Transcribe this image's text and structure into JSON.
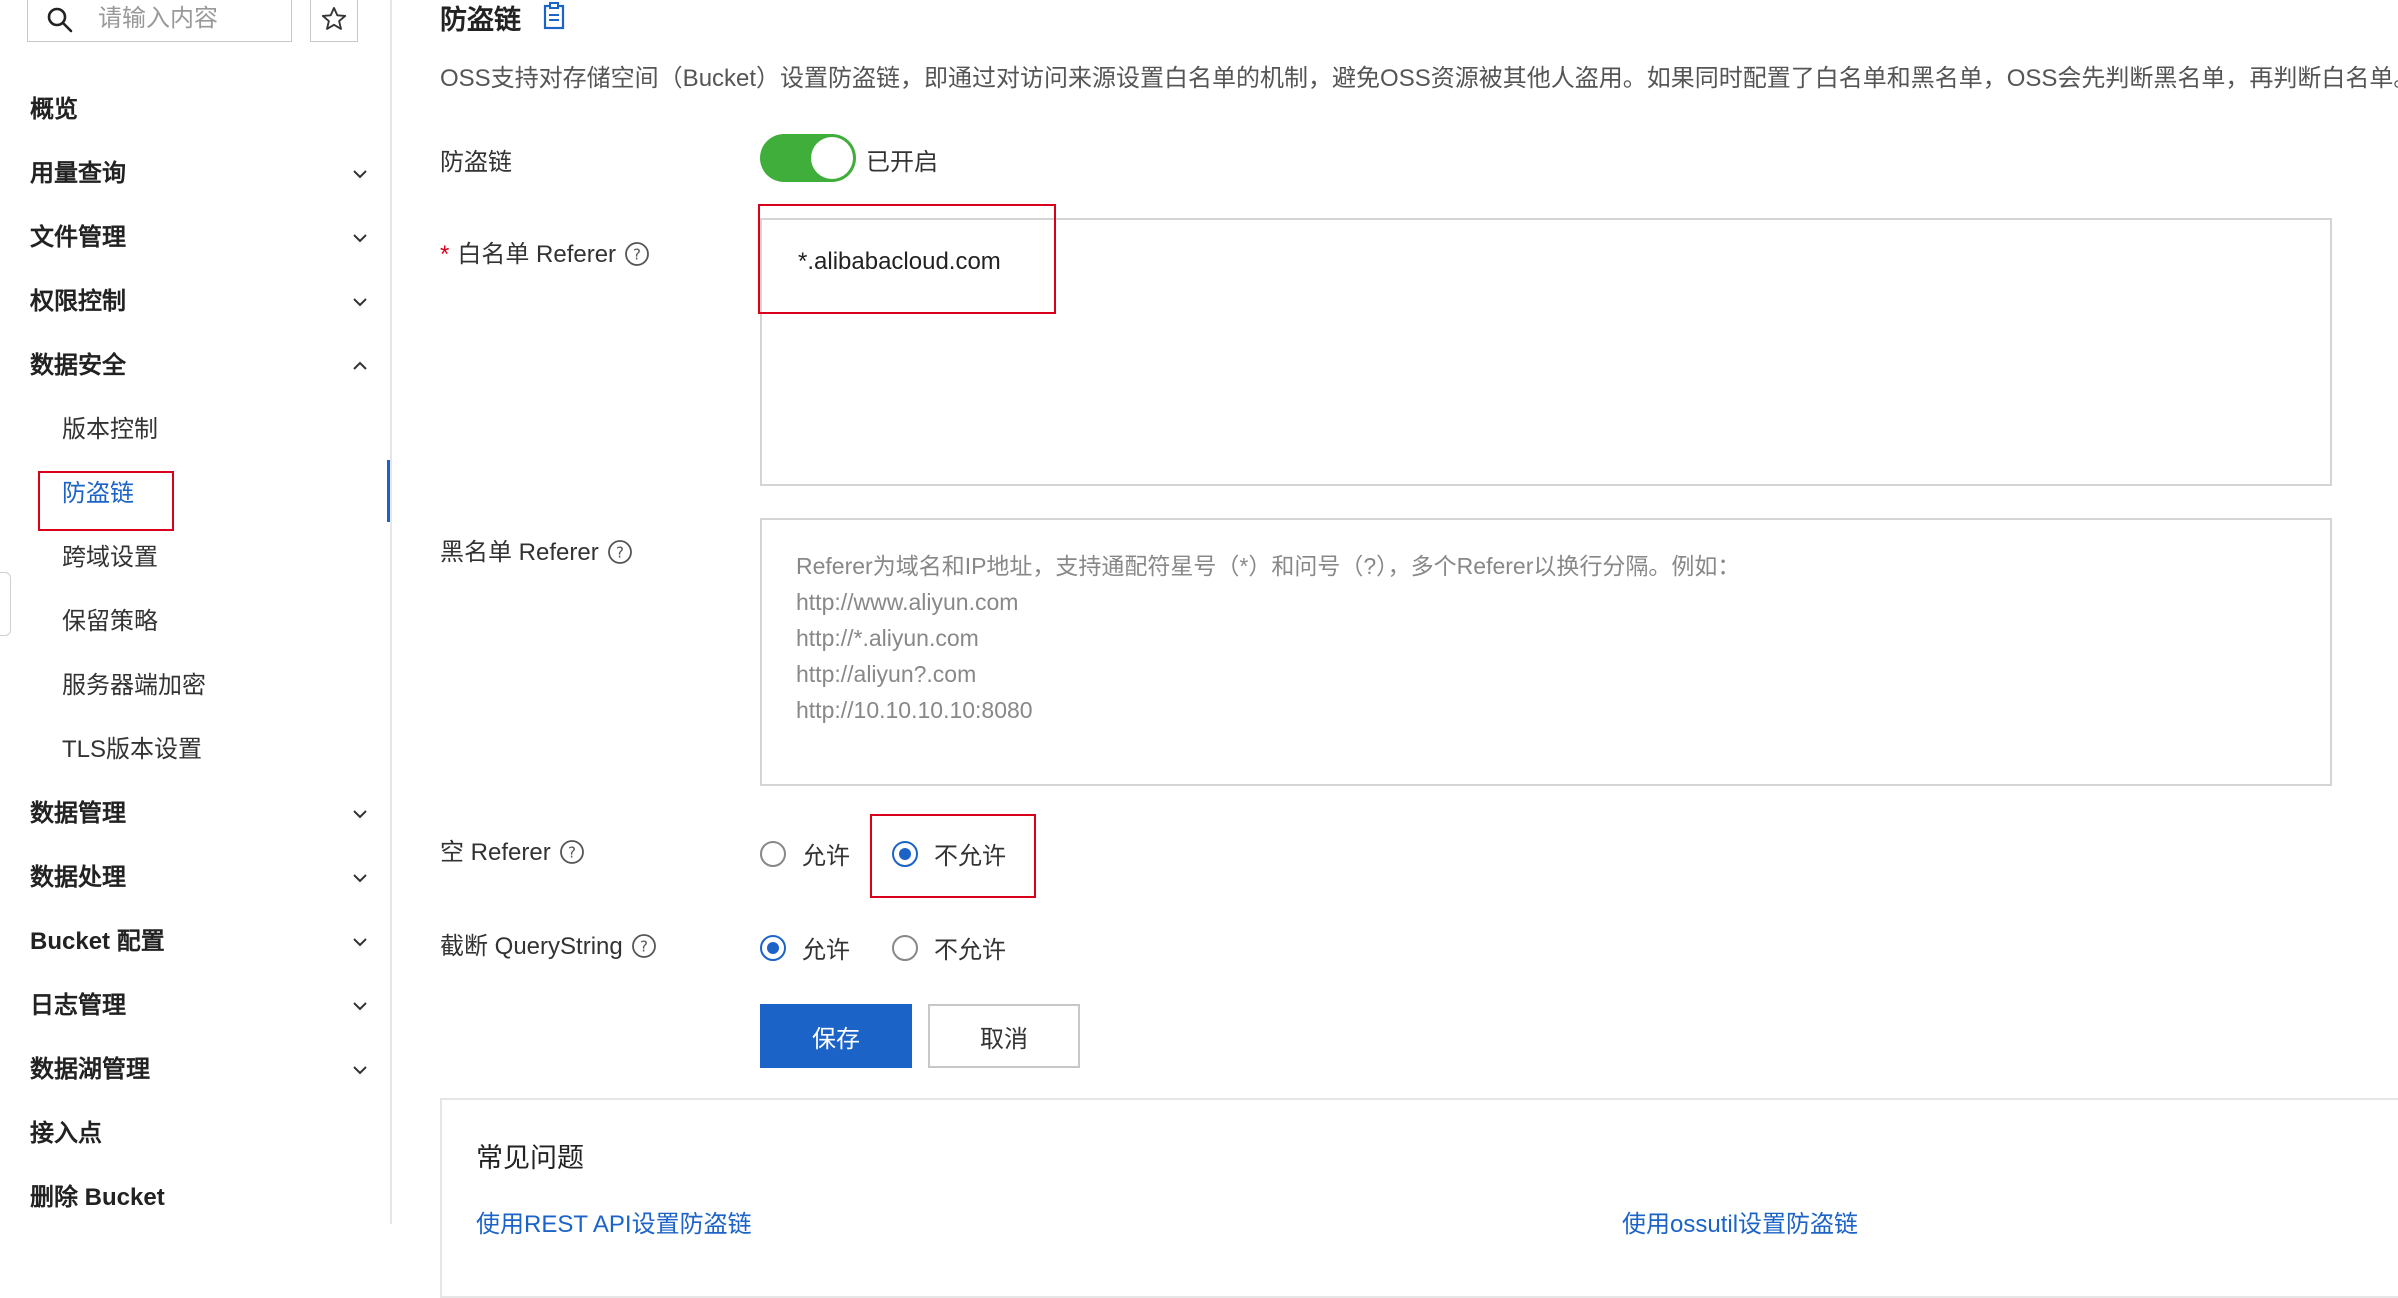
{
  "sidebar": {
    "search_placeholder": "请输入内容",
    "menu": [
      {
        "label": "概览",
        "chevron": "none"
      },
      {
        "label": "用量查询",
        "chevron": "down"
      },
      {
        "label": "文件管理",
        "chevron": "down"
      },
      {
        "label": "权限控制",
        "chevron": "down"
      },
      {
        "label": "数据安全",
        "chevron": "up"
      }
    ],
    "sub_items": [
      "版本控制",
      "防盗链",
      "跨域设置",
      "保留策略",
      "服务器端加密",
      "TLS版本设置"
    ],
    "active_sub_item": "防盗链",
    "menu_after": [
      {
        "label": "数据管理",
        "chevron": "down"
      },
      {
        "label": "数据处理",
        "chevron": "down"
      },
      {
        "label": "Bucket 配置",
        "chevron": "down"
      },
      {
        "label": "日志管理",
        "chevron": "down"
      },
      {
        "label": "数据湖管理",
        "chevron": "down"
      },
      {
        "label": "接入点",
        "chevron": "none"
      },
      {
        "label": "删除 Bucket",
        "chevron": "none"
      }
    ]
  },
  "page": {
    "title": "防盗链",
    "description": "OSS支持对存储空间（Bucket）设置防盗链，即通过对访问来源设置白名单的机制，避免OSS资源被其他人盗用。如果同时配置了白名单和黑名单，OSS会先判断黑名单，再判断白名单。"
  },
  "form": {
    "hotlink_label": "防盗链",
    "hotlink_status": "已开启",
    "hotlink_enabled": true,
    "whitelist_required_mark": "*",
    "whitelist_label": "白名单 Referer",
    "whitelist_value": "*.alibabacloud.com",
    "blacklist_label": "黑名单 Referer",
    "blacklist_placeholder": [
      "Referer为域名和IP地址，支持通配符星号（*）和问号（?），多个Referer以换行分隔。例如：",
      "http://www.aliyun.com",
      "http://*.aliyun.com",
      "http://aliyun?.com",
      "http://10.10.10.10:8080"
    ],
    "empty_referer_label": "空 Referer",
    "empty_referer_options": [
      "允许",
      "不允许"
    ],
    "empty_referer_selected": "不允许",
    "truncate_qs_label": "截断 QueryString",
    "truncate_qs_options": [
      "允许",
      "不允许"
    ],
    "truncate_qs_selected": "允许",
    "save_label": "保存",
    "cancel_label": "取消"
  },
  "faq": {
    "title": "常见问题",
    "links": [
      "使用REST API设置防盗链",
      "使用ossutil设置防盗链"
    ]
  },
  "colors": {
    "primary": "#1c63c8",
    "toggle_on": "#3fae3a",
    "highlight_box": "#d9001b"
  }
}
